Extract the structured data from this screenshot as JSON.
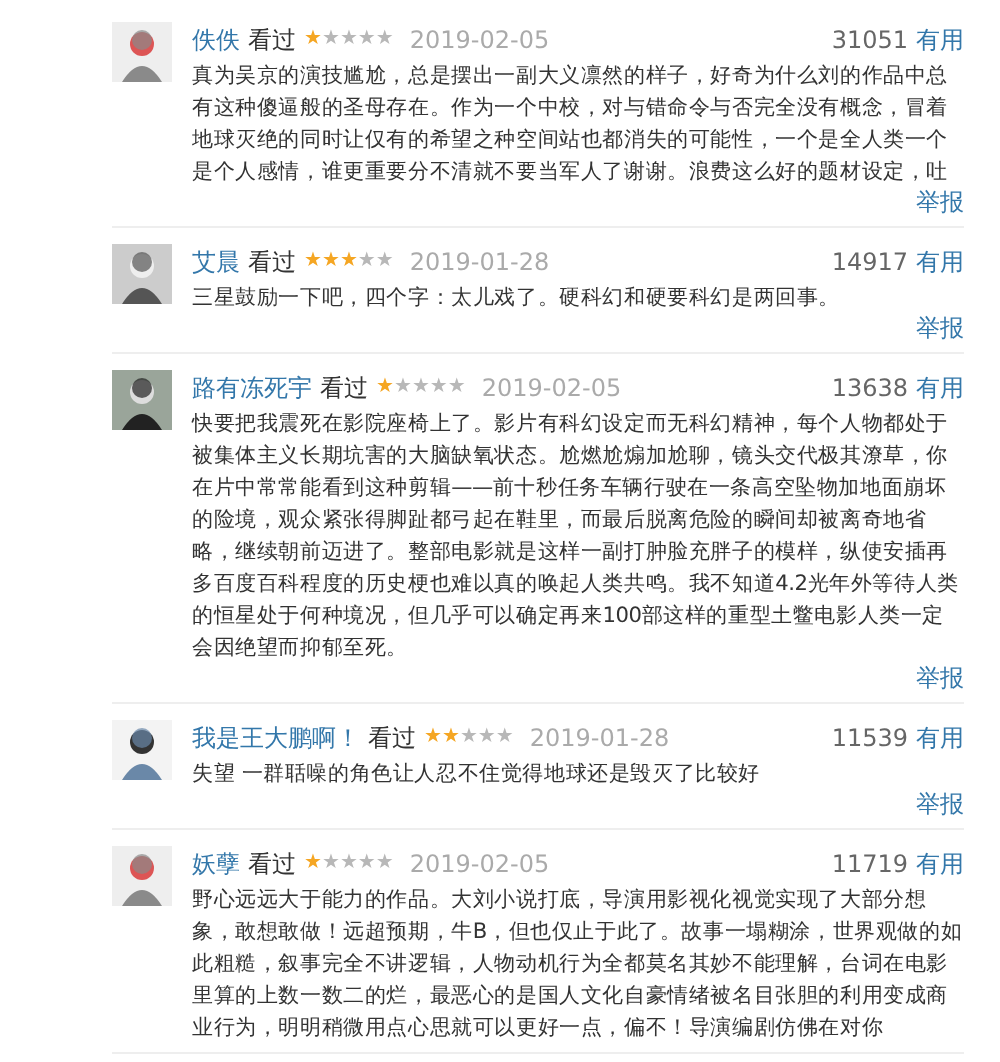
{
  "reviews": [
    {
      "user": "佚佚",
      "status": "看过",
      "stars": 1,
      "date": "2019-02-05",
      "votes": "31051",
      "useful": "有用",
      "text": "真为吴京的演技尴尬，总是摆出一副大义凛然的样子，好奇为什么刘的作品中总有这种傻逼般的圣母存在。作为一个中校，对与错命令与否完全没有概念，冒着地球灭绝的同时让仅有的希望之种空间站也都消失的可能性，一个是全人类一个是个人感情，谁更重要分不清就不要当军人了谢谢。浪费这么好的题材设定，吐",
      "report": "举报"
    },
    {
      "user": "艾晨",
      "status": "看过",
      "stars": 3,
      "date": "2019-01-28",
      "votes": "14917",
      "useful": "有用",
      "text": "三星鼓励一下吧，四个字：太儿戏了。硬科幻和硬要科幻是两回事。",
      "report": "举报"
    },
    {
      "user": "路有冻死宇",
      "status": "看过",
      "stars": 1,
      "date": "2019-02-05",
      "votes": "13638",
      "useful": "有用",
      "text": "快要把我震死在影院座椅上了。影片有科幻设定而无科幻精神，每个人物都处于被集体主义长期坑害的大脑缺氧状态。尬燃尬煽加尬聊，镜头交代极其潦草，你在片中常常能看到这种剪辑——前十秒任务车辆行驶在一条高空坠物加地面崩坏的险境，观众紧张得脚趾都弓起在鞋里，而最后脱离危险的瞬间却被离奇地省略，继续朝前迈进了。整部电影就是这样一副打肿脸充胖子的模样，纵使安插再多百度百科程度的历史梗也难以真的唤起人类共鸣。我不知道4.2光年外等待人类的恒星处于何种境况，但几乎可以确定再来100部这样的重型土鳖电影人类一定会因绝望而抑郁至死。",
      "report": "举报"
    },
    {
      "user": "我是王大鹏啊！",
      "status": "看过",
      "stars": 2,
      "date": "2019-01-28",
      "votes": "11539",
      "useful": "有用",
      "text": "失望 一群聒噪的角色让人忍不住觉得地球还是毁灭了比较好",
      "report": "举报"
    },
    {
      "user": "妖孽",
      "status": "看过",
      "stars": 1,
      "date": "2019-02-05",
      "votes": "11719",
      "useful": "有用",
      "text": "野心远远大于能力的作品。大刘小说打底，导演用影视化视觉实现了大部分想象，敢想敢做！远超预期，牛B，但也仅止于此了。故事一塌糊涂，世界观做的如此粗糙，叙事完全不讲逻辑，人物动机行为全都莫名其妙不能理解，台词在电影里算的上数一数二的烂，最恶心的是国人文化自豪情绪被名目张胆的利用变成商业行为，明明稍微用点心思就可以更好一点，偏不！导演编剧仿佛在对你"
    }
  ]
}
